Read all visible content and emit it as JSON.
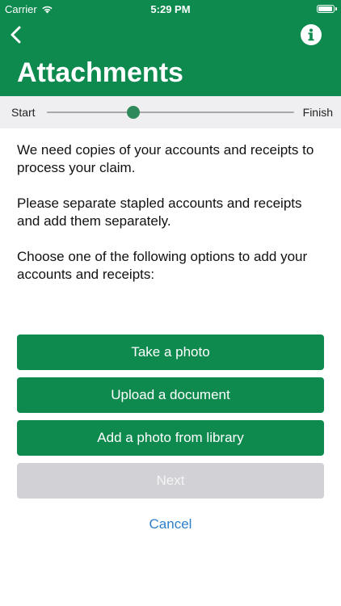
{
  "status_bar": {
    "carrier": "Carrier",
    "time": "5:29 PM",
    "battery_level": 0.95
  },
  "header": {
    "title": "Attachments"
  },
  "progress": {
    "start_label": "Start",
    "finish_label": "Finish",
    "value": 0.35
  },
  "instructions": [
    "We need copies of your accounts and receipts to process your claim.",
    "Please separate stapled accounts and receipts and add them separately.",
    "Choose one of the following options to add your accounts and receipts:"
  ],
  "buttons": {
    "take_photo": "Take a photo",
    "upload_document": "Upload a document",
    "photo_library": "Add a photo from library",
    "next": "Next",
    "cancel": "Cancel"
  },
  "colors": {
    "brand_green": "#0e8a4f",
    "link_blue": "#2d7fc8",
    "disabled_gray": "#d2d2d6"
  }
}
